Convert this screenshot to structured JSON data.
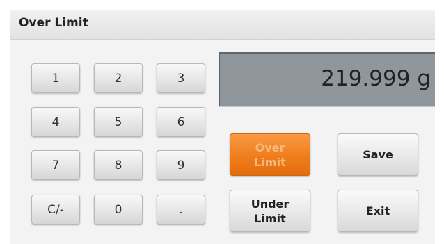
{
  "window": {
    "title": "Over Limit"
  },
  "keypad": {
    "keys": [
      "1",
      "2",
      "3",
      "4",
      "5",
      "6",
      "7",
      "8",
      "9",
      "C/-",
      "0",
      "."
    ]
  },
  "display": {
    "value": "219.999 g"
  },
  "buttons": {
    "over_limit": {
      "line1": "Over",
      "line2": "Limit",
      "selected": true
    },
    "under_limit": {
      "line1": "Under",
      "line2": "Limit",
      "selected": false
    },
    "save": "Save",
    "exit": "Exit"
  },
  "colors": {
    "accent_orange": "#f07d1c",
    "display_background": "#8f979c"
  }
}
